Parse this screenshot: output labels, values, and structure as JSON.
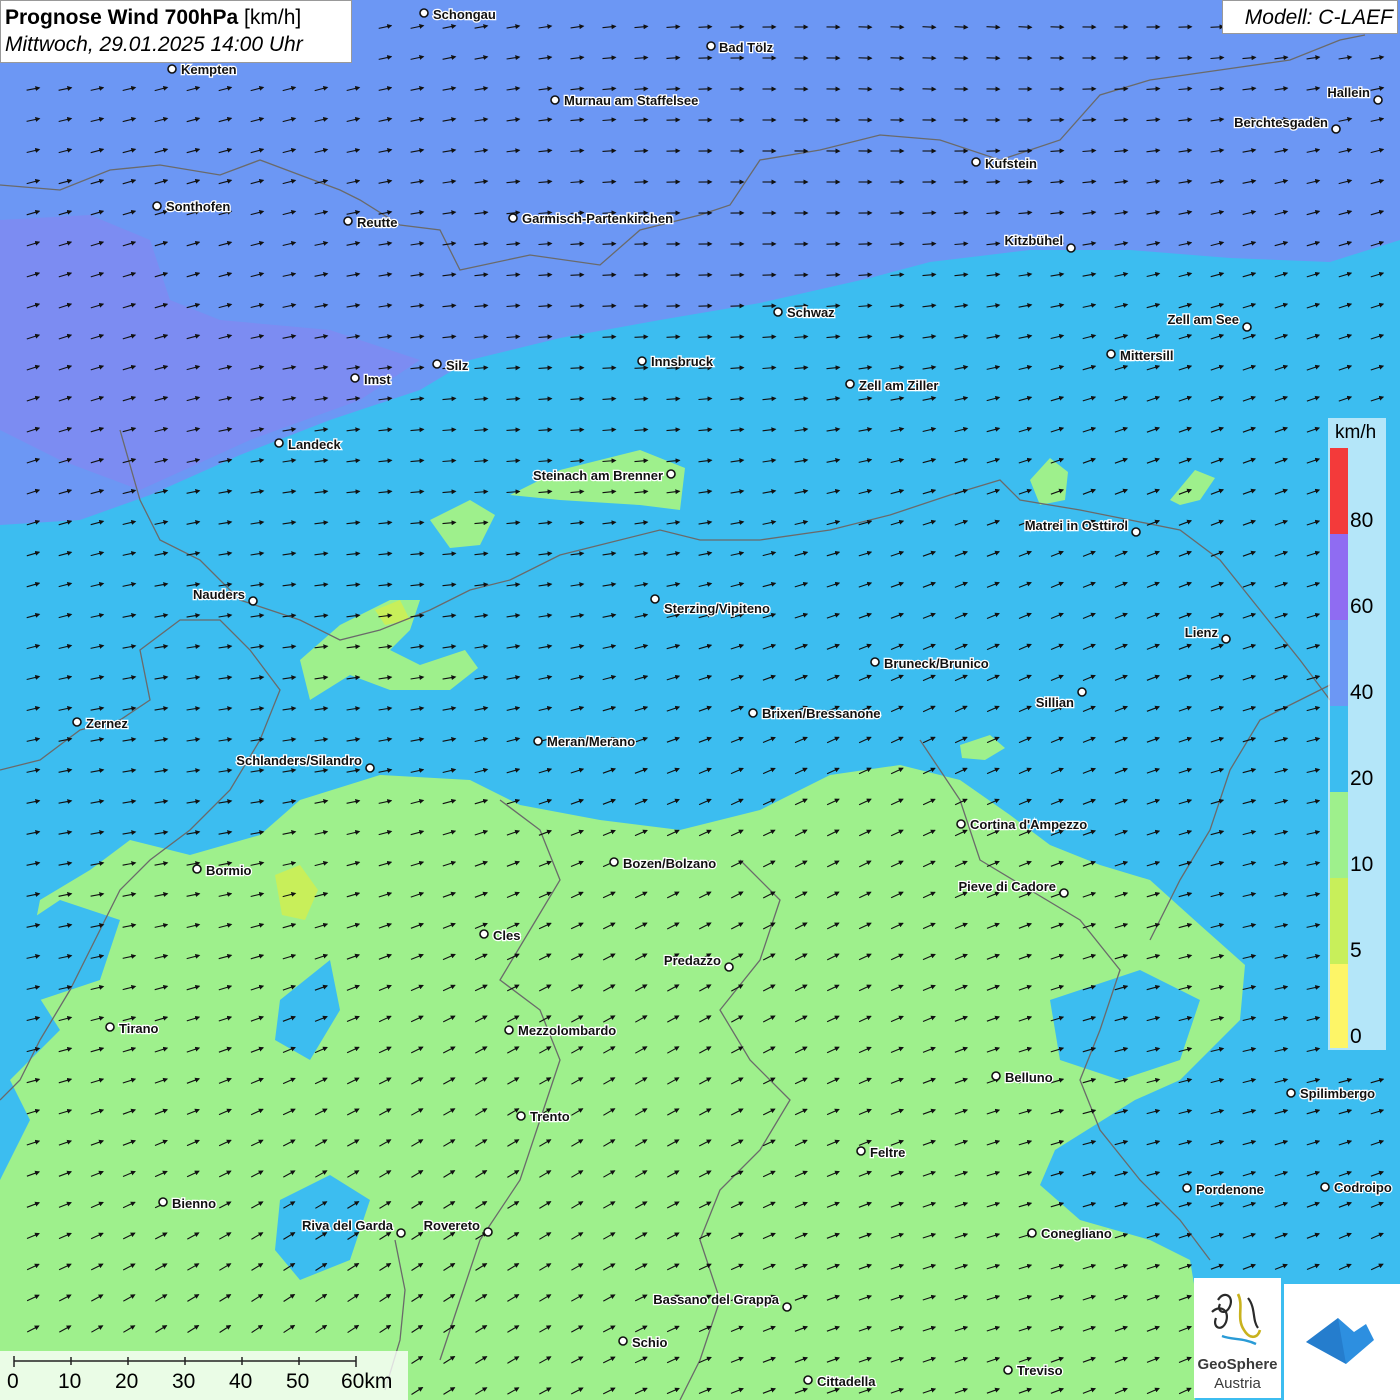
{
  "header": {
    "title_bold": "Prognose Wind 700hPa",
    "title_unit": "[km/h]",
    "datetime": "Mittwoch, 29.01.2025 14:00 Uhr",
    "model": "Modell: C-LAEF"
  },
  "legend": {
    "unit": "km/h",
    "labels": [
      "80",
      "60",
      "40",
      "20",
      "10",
      "5",
      "0"
    ],
    "classes": [
      {
        "from": 0,
        "to": 5,
        "color": "#fdf567"
      },
      {
        "from": 5,
        "to": 10,
        "color": "#c8ef5a"
      },
      {
        "from": 10,
        "to": 20,
        "color": "#9ef08c"
      },
      {
        "from": 20,
        "to": 40,
        "color": "#3cbdf0"
      },
      {
        "from": 40,
        "to": 60,
        "color": "#6c97f4"
      },
      {
        "from": 60,
        "to": 80,
        "color": "#8f6cf2"
      },
      {
        "from": 80,
        "to": 100,
        "color": "#f33a3a"
      }
    ]
  },
  "scale": {
    "labels": [
      "0",
      "10",
      "20",
      "30",
      "40",
      "50",
      "60km"
    ]
  },
  "cities": [
    "Schongau",
    "Bad Tölz",
    "Kempten",
    "Murnau am Staffelsee",
    "Hallein",
    "Berchtesgaden",
    "Kufstein",
    "Sonthofen",
    "Reutte",
    "Garmisch-Partenkirchen",
    "Kitzbühel",
    "Schwaz",
    "Zell am See",
    "Mittersill",
    "Innsbruck",
    "Imst",
    "Silz",
    "Zell am Ziller",
    "Landeck",
    "Steinach am Brenner",
    "Matrei in Osttirol",
    "Nauders",
    "Sterzing/Vipiteno",
    "Lienz",
    "Bruneck/Brunico",
    "Sillian",
    "Brixen/Bressanone",
    "Zernez",
    "Meran/Merano",
    "Schlanders/Silandro",
    "Cortina d'Ampezzo",
    "Bozen/Bolzano",
    "Bormio",
    "Pieve di Cadore",
    "Cles",
    "Predazzo",
    "Tirano",
    "Mezzolombardo",
    "Belluno",
    "Spilimbergo",
    "Trento",
    "Feltre",
    "Pordenone",
    "Codroipo",
    "Bienno",
    "Riva del Garda",
    "Rovereto",
    "Conegliano",
    "Bassano del Grappa",
    "Schio",
    "Treviso",
    "Cittadella"
  ],
  "logos": {
    "geosphere_name": "GeoSphere",
    "geosphere_sub": "Austria"
  },
  "colors": {
    "zone_weak": "#9ef08c",
    "zone_moderate": "#3cbdf0",
    "zone_strong": "#6c97f4",
    "zone_very_strong": "#8f6cf2",
    "zone_local_calm": "#c8ef5a",
    "border": "#6a6a6a",
    "arrow": "#111111",
    "app_logo_blue": "#2d8fe0"
  }
}
